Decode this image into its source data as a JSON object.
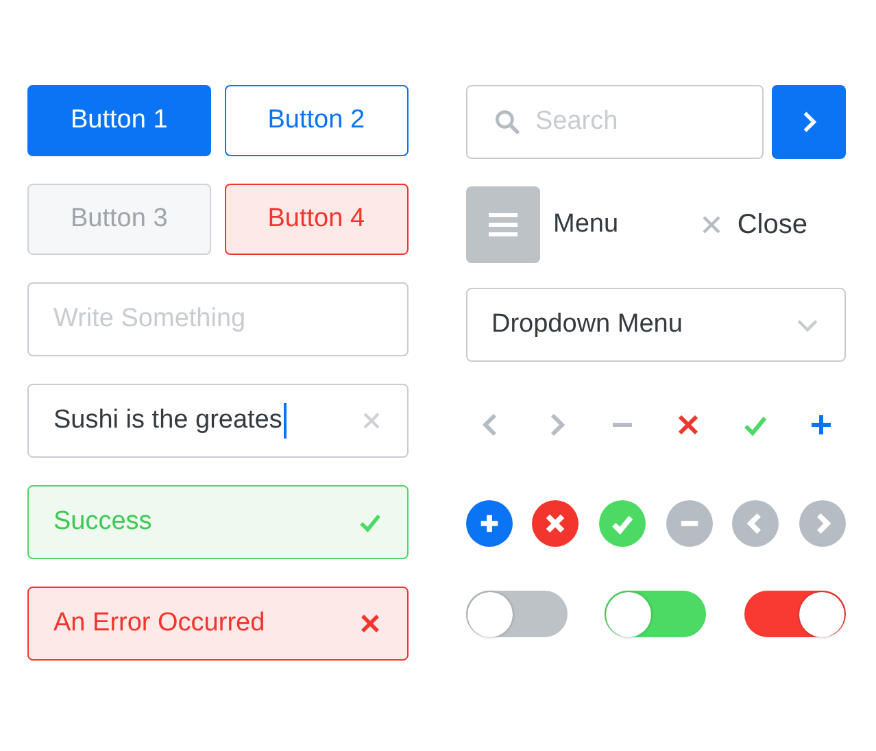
{
  "buttons": [
    {
      "label": "Button 1",
      "kind": "primary"
    },
    {
      "label": "Button 2",
      "kind": "outline"
    },
    {
      "label": "Button 3",
      "kind": "disabled"
    },
    {
      "label": "Button 4",
      "kind": "danger"
    }
  ],
  "fields": [
    {
      "kind": "empty",
      "placeholder": "Write Something"
    },
    {
      "kind": "filled",
      "value": "Sushi is the greates"
    },
    {
      "kind": "success",
      "text": "Success"
    },
    {
      "kind": "error",
      "text": "An Error Occurred"
    }
  ],
  "search": {
    "placeholder": "Search"
  },
  "menu": {
    "label": "Menu"
  },
  "close": {
    "label": "Close"
  },
  "dropdown": {
    "label": "Dropdown Menu"
  },
  "icons": [
    {
      "kind": "chevron-left",
      "color": "#b6bcc3"
    },
    {
      "kind": "chevron-right",
      "color": "#b6bcc3"
    },
    {
      "kind": "minus",
      "color": "#b6bcc3"
    },
    {
      "kind": "x",
      "color": "#f2352d"
    },
    {
      "kind": "check",
      "color": "#4cd964"
    },
    {
      "kind": "plus",
      "color": "#0a74f5"
    }
  ],
  "circle_icons": [
    {
      "kind": "plus",
      "color": "#0a74f5"
    },
    {
      "kind": "x",
      "color": "#f2352d"
    },
    {
      "kind": "check",
      "color": "#4cd964"
    },
    {
      "kind": "minus",
      "color": "#b6bcc3"
    },
    {
      "kind": "chevron-left",
      "color": "#b6bcc3"
    },
    {
      "kind": "chevron-right",
      "color": "#b6bcc3"
    }
  ],
  "toggles": [
    {
      "on": false,
      "color": "#bdc2c7"
    },
    {
      "on": false,
      "color": "#4cd964"
    },
    {
      "on": true,
      "color": "#f83a32"
    }
  ]
}
